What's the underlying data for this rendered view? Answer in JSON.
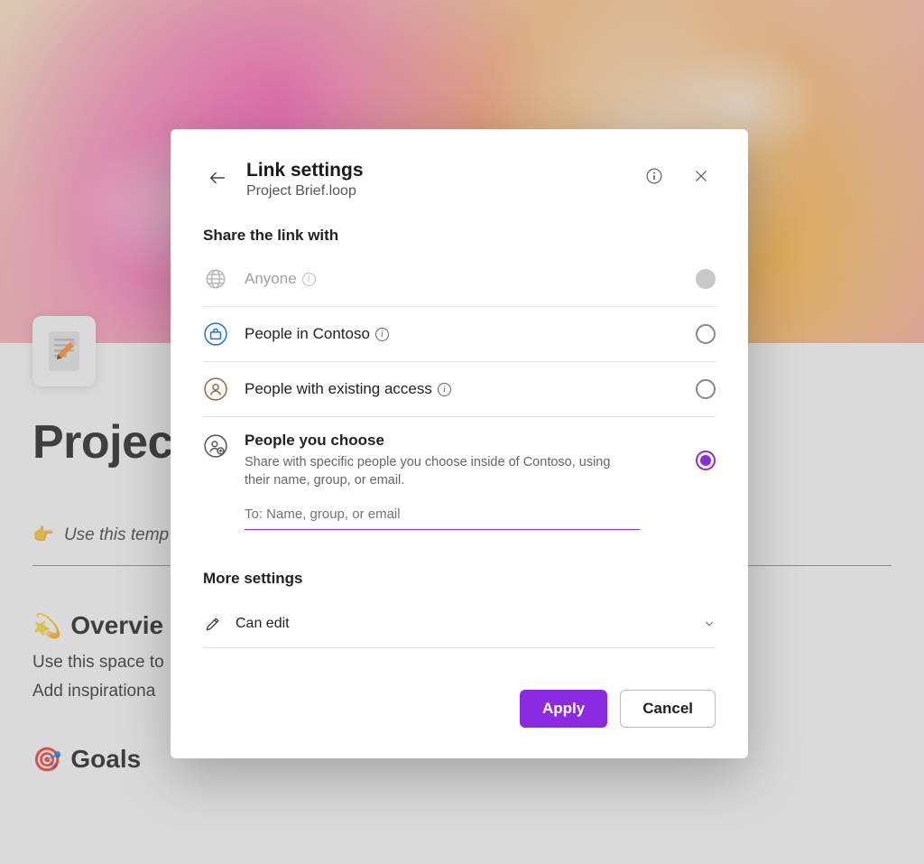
{
  "page": {
    "title": "Projec",
    "hint_emoji": "👉",
    "hint_text": "Use this temp",
    "overview_emoji": "💫",
    "overview_heading": "Overvie",
    "overview_line1": "Use this space to",
    "overview_line2": "Add inspirationa",
    "goals_emoji": "🎯",
    "goals_heading": "Goals"
  },
  "dialog": {
    "title": "Link settings",
    "subtitle": "Project Brief.loop",
    "share_heading": "Share the link with",
    "options": {
      "anyone": {
        "label": "Anyone"
      },
      "org": {
        "label": "People in Contoso"
      },
      "existing": {
        "label": "People with existing access"
      },
      "choose": {
        "label": "People you choose",
        "description": "Share with specific people you choose inside of Contoso, using their name, group, or email."
      }
    },
    "to_placeholder": "To: Name, group, or email",
    "more_heading": "More settings",
    "permission": "Can edit",
    "apply": "Apply",
    "cancel": "Cancel"
  }
}
